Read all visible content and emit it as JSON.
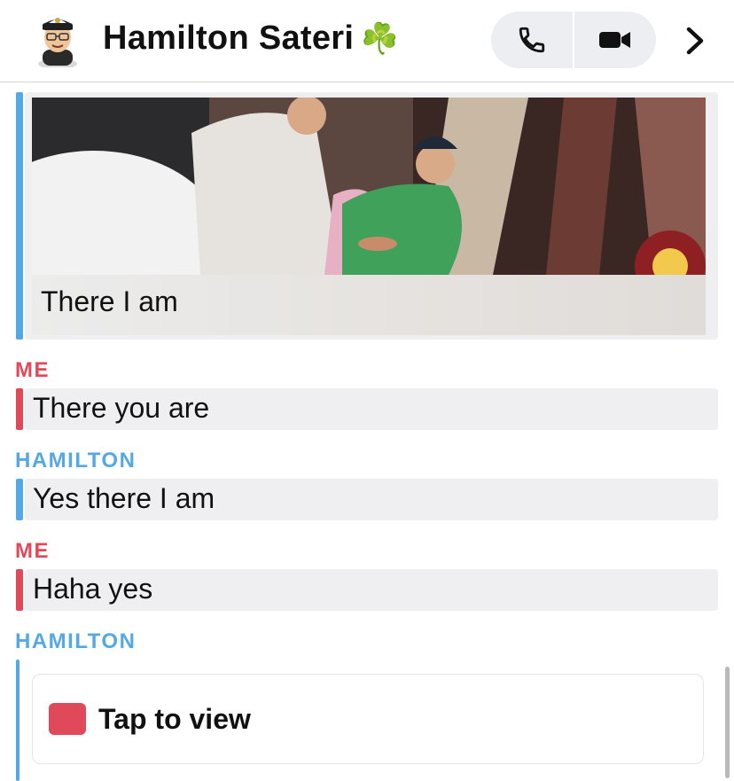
{
  "header": {
    "contact_name": "Hamilton Sateri",
    "name_emoji": "☘️",
    "call_icon": "phone-icon",
    "video_icon": "video-camera-icon",
    "more_icon": "chevron-right-icon"
  },
  "colors": {
    "me": "#e0495a",
    "them": "#55a8e6",
    "bubble": "#efeff2"
  },
  "messages": [
    {
      "type": "photo",
      "sender": "",
      "caption": "There I am"
    },
    {
      "type": "text",
      "sender": "ME",
      "text": "There you are"
    },
    {
      "type": "text",
      "sender": "HAMILTON",
      "text": "Yes there I am"
    },
    {
      "type": "text",
      "sender": "ME",
      "text": "Haha yes"
    },
    {
      "type": "snap",
      "sender": "HAMILTON",
      "label": "Tap to view"
    }
  ]
}
